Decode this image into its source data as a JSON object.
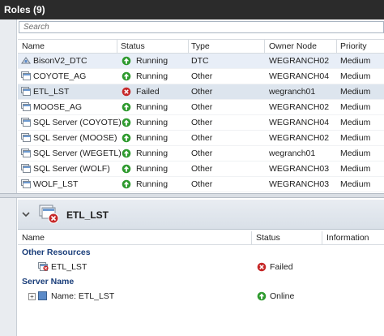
{
  "title": "Roles (9)",
  "search": {
    "placeholder": "Search"
  },
  "roles": {
    "columns": [
      "Name",
      "Status",
      "Type",
      "Owner Node",
      "Priority"
    ],
    "rows": [
      {
        "name": "BisonV2_DTC",
        "status": "Running",
        "type": "DTC",
        "owner": "WEGRANCH02",
        "priority": "Medium"
      },
      {
        "name": "COYOTE_AG",
        "status": "Running",
        "type": "Other",
        "owner": "WEGRANCH04",
        "priority": "Medium"
      },
      {
        "name": "ETL_LST",
        "status": "Failed",
        "type": "Other",
        "owner": "wegranch01",
        "priority": "Medium"
      },
      {
        "name": "MOOSE_AG",
        "status": "Running",
        "type": "Other",
        "owner": "WEGRANCH02",
        "priority": "Medium"
      },
      {
        "name": "SQL Server (COYOTE)",
        "status": "Running",
        "type": "Other",
        "owner": "WEGRANCH04",
        "priority": "Medium"
      },
      {
        "name": "SQL Server (MOOSE)",
        "status": "Running",
        "type": "Other",
        "owner": "WEGRANCH02",
        "priority": "Medium"
      },
      {
        "name": "SQL Server (WEGETL)",
        "status": "Running",
        "type": "Other",
        "owner": "wegranch01",
        "priority": "Medium"
      },
      {
        "name": "SQL Server (WOLF)",
        "status": "Running",
        "type": "Other",
        "owner": "WEGRANCH03",
        "priority": "Medium"
      },
      {
        "name": "WOLF_LST",
        "status": "Running",
        "type": "Other",
        "owner": "WEGRANCH03",
        "priority": "Medium"
      }
    ]
  },
  "details": {
    "title": "ETL_LST",
    "columns": [
      "Name",
      "Status",
      "Information"
    ],
    "groups": [
      {
        "label": "Other Resources",
        "items": [
          {
            "name": "ETL_LST",
            "status": "Failed"
          }
        ]
      },
      {
        "label": "Server Name",
        "items": [
          {
            "name": "Name: ETL_LST",
            "status": "Online"
          }
        ]
      }
    ]
  },
  "colors": {
    "running": "#2e9a2e",
    "failed": "#c62828",
    "titlebar": "#2b2b2b",
    "group_text": "#1a3e7a"
  }
}
